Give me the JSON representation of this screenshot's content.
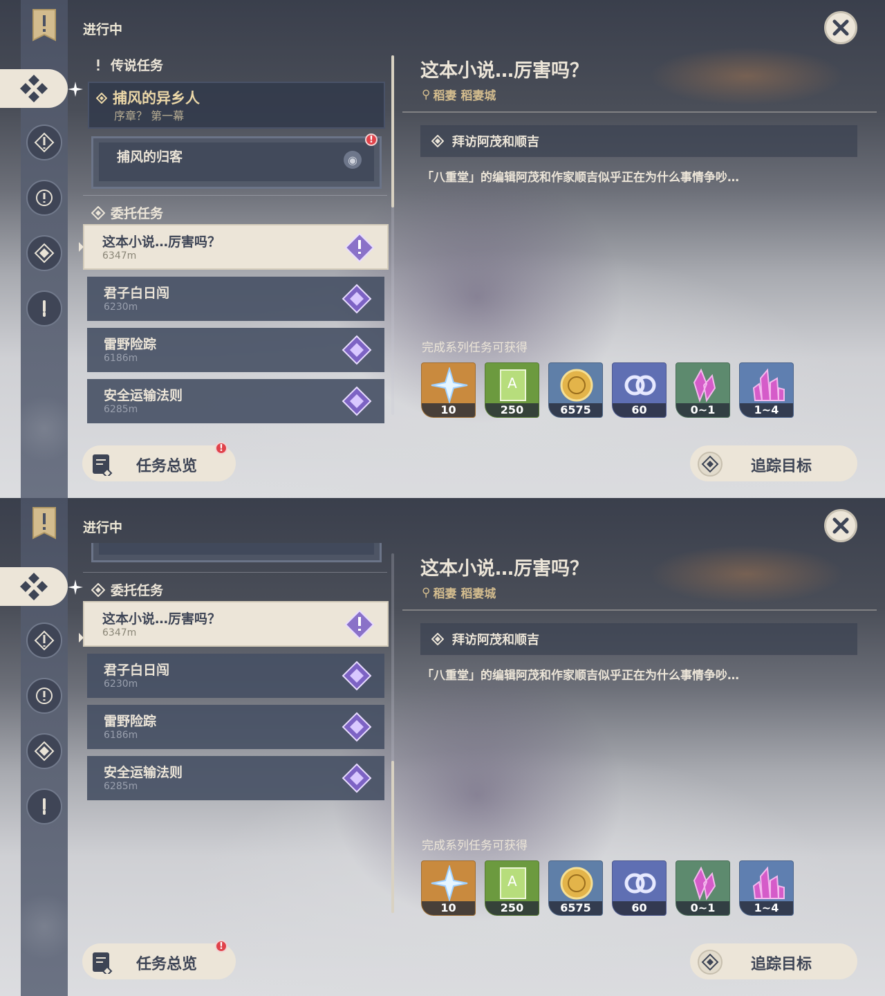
{
  "header": {
    "status_label": "进行中"
  },
  "legend": {
    "section_title": "传说任务",
    "quest_title": "捕风的异乡人",
    "quest_subtitle": "序章？ 第一幕",
    "sub_quest": "捕风的归客",
    "alert_badge": "!"
  },
  "commission": {
    "section_title": "委托任务",
    "items": [
      {
        "title": "这本小说…厉害吗？",
        "distance": "6347m"
      },
      {
        "title": "君子白日闯",
        "distance": "6230m"
      },
      {
        "title": "雷野险踪",
        "distance": "6186m"
      },
      {
        "title": "安全运输法则",
        "distance": "6285m"
      }
    ]
  },
  "detail": {
    "title": "这本小说…厉害吗？",
    "location": "稻妻 稻妻城",
    "step": "拜访阿茂和顺吉",
    "description": "「八重堂」的编辑阿茂和作家顺吉似乎正在为什么事情争吵…",
    "rewards_label": "完成系列任务可获得",
    "rewards": [
      {
        "icon": "primogem-icon",
        "count": "10",
        "bg": "#c98a3e"
      },
      {
        "icon": "adventure-exp-icon",
        "count": "250",
        "bg": "#6c9a3f"
      },
      {
        "icon": "mora-icon",
        "count": "6575",
        "bg": "#5f7fa8"
      },
      {
        "icon": "companionship-exp-icon",
        "count": "60",
        "bg": "#5f6fb3"
      },
      {
        "icon": "crystal-icon",
        "count": "0~1",
        "bg": "#5d8a6e"
      },
      {
        "icon": "crystal-cluster-icon",
        "count": "1~4",
        "bg": "#5f7fb0"
      }
    ]
  },
  "buttons": {
    "overview": "任务总览",
    "track": "追踪目标",
    "overview_badge": "!"
  },
  "colors": {
    "accent": "#ece5d8",
    "gold": "#d3bc8e",
    "alert": "#e0424a"
  }
}
